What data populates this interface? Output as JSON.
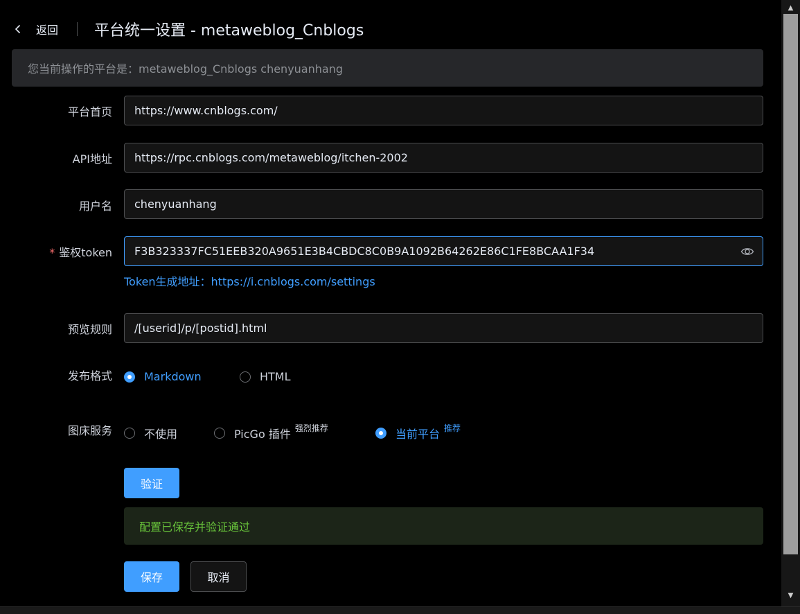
{
  "header": {
    "back_label": "返回",
    "title": "平台统一设置 - metaweblog_Cnblogs"
  },
  "notice": {
    "text": "您当前操作的平台是：metaweblog_Cnblogs chenyuanhang"
  },
  "form": {
    "homepage": {
      "label": "平台首页",
      "value": "https://www.cnblogs.com/"
    },
    "api": {
      "label": "API地址",
      "value": "https://rpc.cnblogs.com/metaweblog/itchen-2002"
    },
    "username": {
      "label": "用户名",
      "value": "chenyuanhang"
    },
    "token": {
      "required_mark": "*",
      "label": "鉴权token",
      "value": "F3B323337FC51EEB320A9651E3B4CBDC8C0B9A1092B64262E86C1FE8BCAA1F34",
      "link_text": "Token生成地址：https://i.cnblogs.com/settings",
      "icon": "eye-icon"
    },
    "preview_rule": {
      "label": "预览规则",
      "value": "/[userid]/p/[postid].html"
    },
    "publish_format": {
      "label": "发布格式",
      "options": [
        "Markdown",
        "HTML"
      ],
      "selected": "Markdown"
    },
    "image_service": {
      "label": "图床服务",
      "options": [
        {
          "label": "不使用",
          "badge": ""
        },
        {
          "label": "PicGo 插件",
          "badge": "强烈推荐"
        },
        {
          "label": "当前平台",
          "badge": "推荐"
        }
      ],
      "selected": "当前平台"
    }
  },
  "verify_button": "验证",
  "success_message": "配置已保存并验证通过",
  "save_button": "保存",
  "cancel_button": "取消",
  "colors": {
    "accent": "#409eff",
    "success": "#67c23a",
    "required": "#f56c6c",
    "background": "#000000"
  }
}
